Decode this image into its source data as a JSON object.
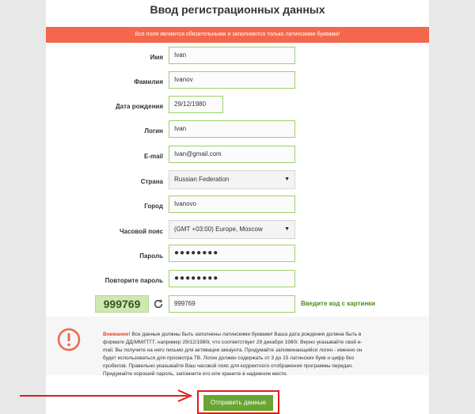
{
  "title": "Ввод регистрационных данных",
  "notice": "Все поля являются обязательными и заполняются только латинскими буквами!",
  "fields": [
    {
      "label": "Имя",
      "value": "Ivan"
    },
    {
      "label": "Фамилия",
      "value": "Ivanov"
    },
    {
      "label": "Дата рождения",
      "value": "29/12/1980"
    },
    {
      "label": "Логин",
      "value": "Ivan"
    },
    {
      "label": "E-mail",
      "value": "Ivan@gmail.com"
    },
    {
      "label": "Страна",
      "value": "Russian Federation"
    },
    {
      "label": "Город",
      "value": "Ivanovo"
    },
    {
      "label": "Часовой пояс",
      "value": "(GMT +03:00) Europe, Moscow"
    },
    {
      "label": "Пароль",
      "value": "●●●●●●●●"
    },
    {
      "label": "Повторите пароль",
      "value": "●●●●●●●●"
    }
  ],
  "captcha": {
    "image_text": "999769",
    "value": "999769",
    "hint": "Введите код с картинки"
  },
  "warning": {
    "attention": "Внимание!",
    "text": " Все данные должны быть заполнены латинскими буквами! Ваша дата рождения должна быть в формате ДД/ММ/ГГГГ, например 29/12/1980г, что соответствует 29 декабря 1980г. Верно указывайте свой e-mail. Вы получите на него письмо для активации аккаунта. Придумайте запоминающийся логин - именно он будет использоваться для просмотра ТВ. Логин должен содержать от 3 до 15 латинских букв и цифр без пробелов. Правильно указывайте Ваш часовой пояс для корректного отображения программы передач. Придумайте хороший пароль, запомните его или храните в надежном месте."
  },
  "submit_label": "Отправить данные",
  "colors": {
    "accent_green": "#6aa433",
    "notice_bg": "#f4674c",
    "highlight_red": "#e11b1b"
  }
}
